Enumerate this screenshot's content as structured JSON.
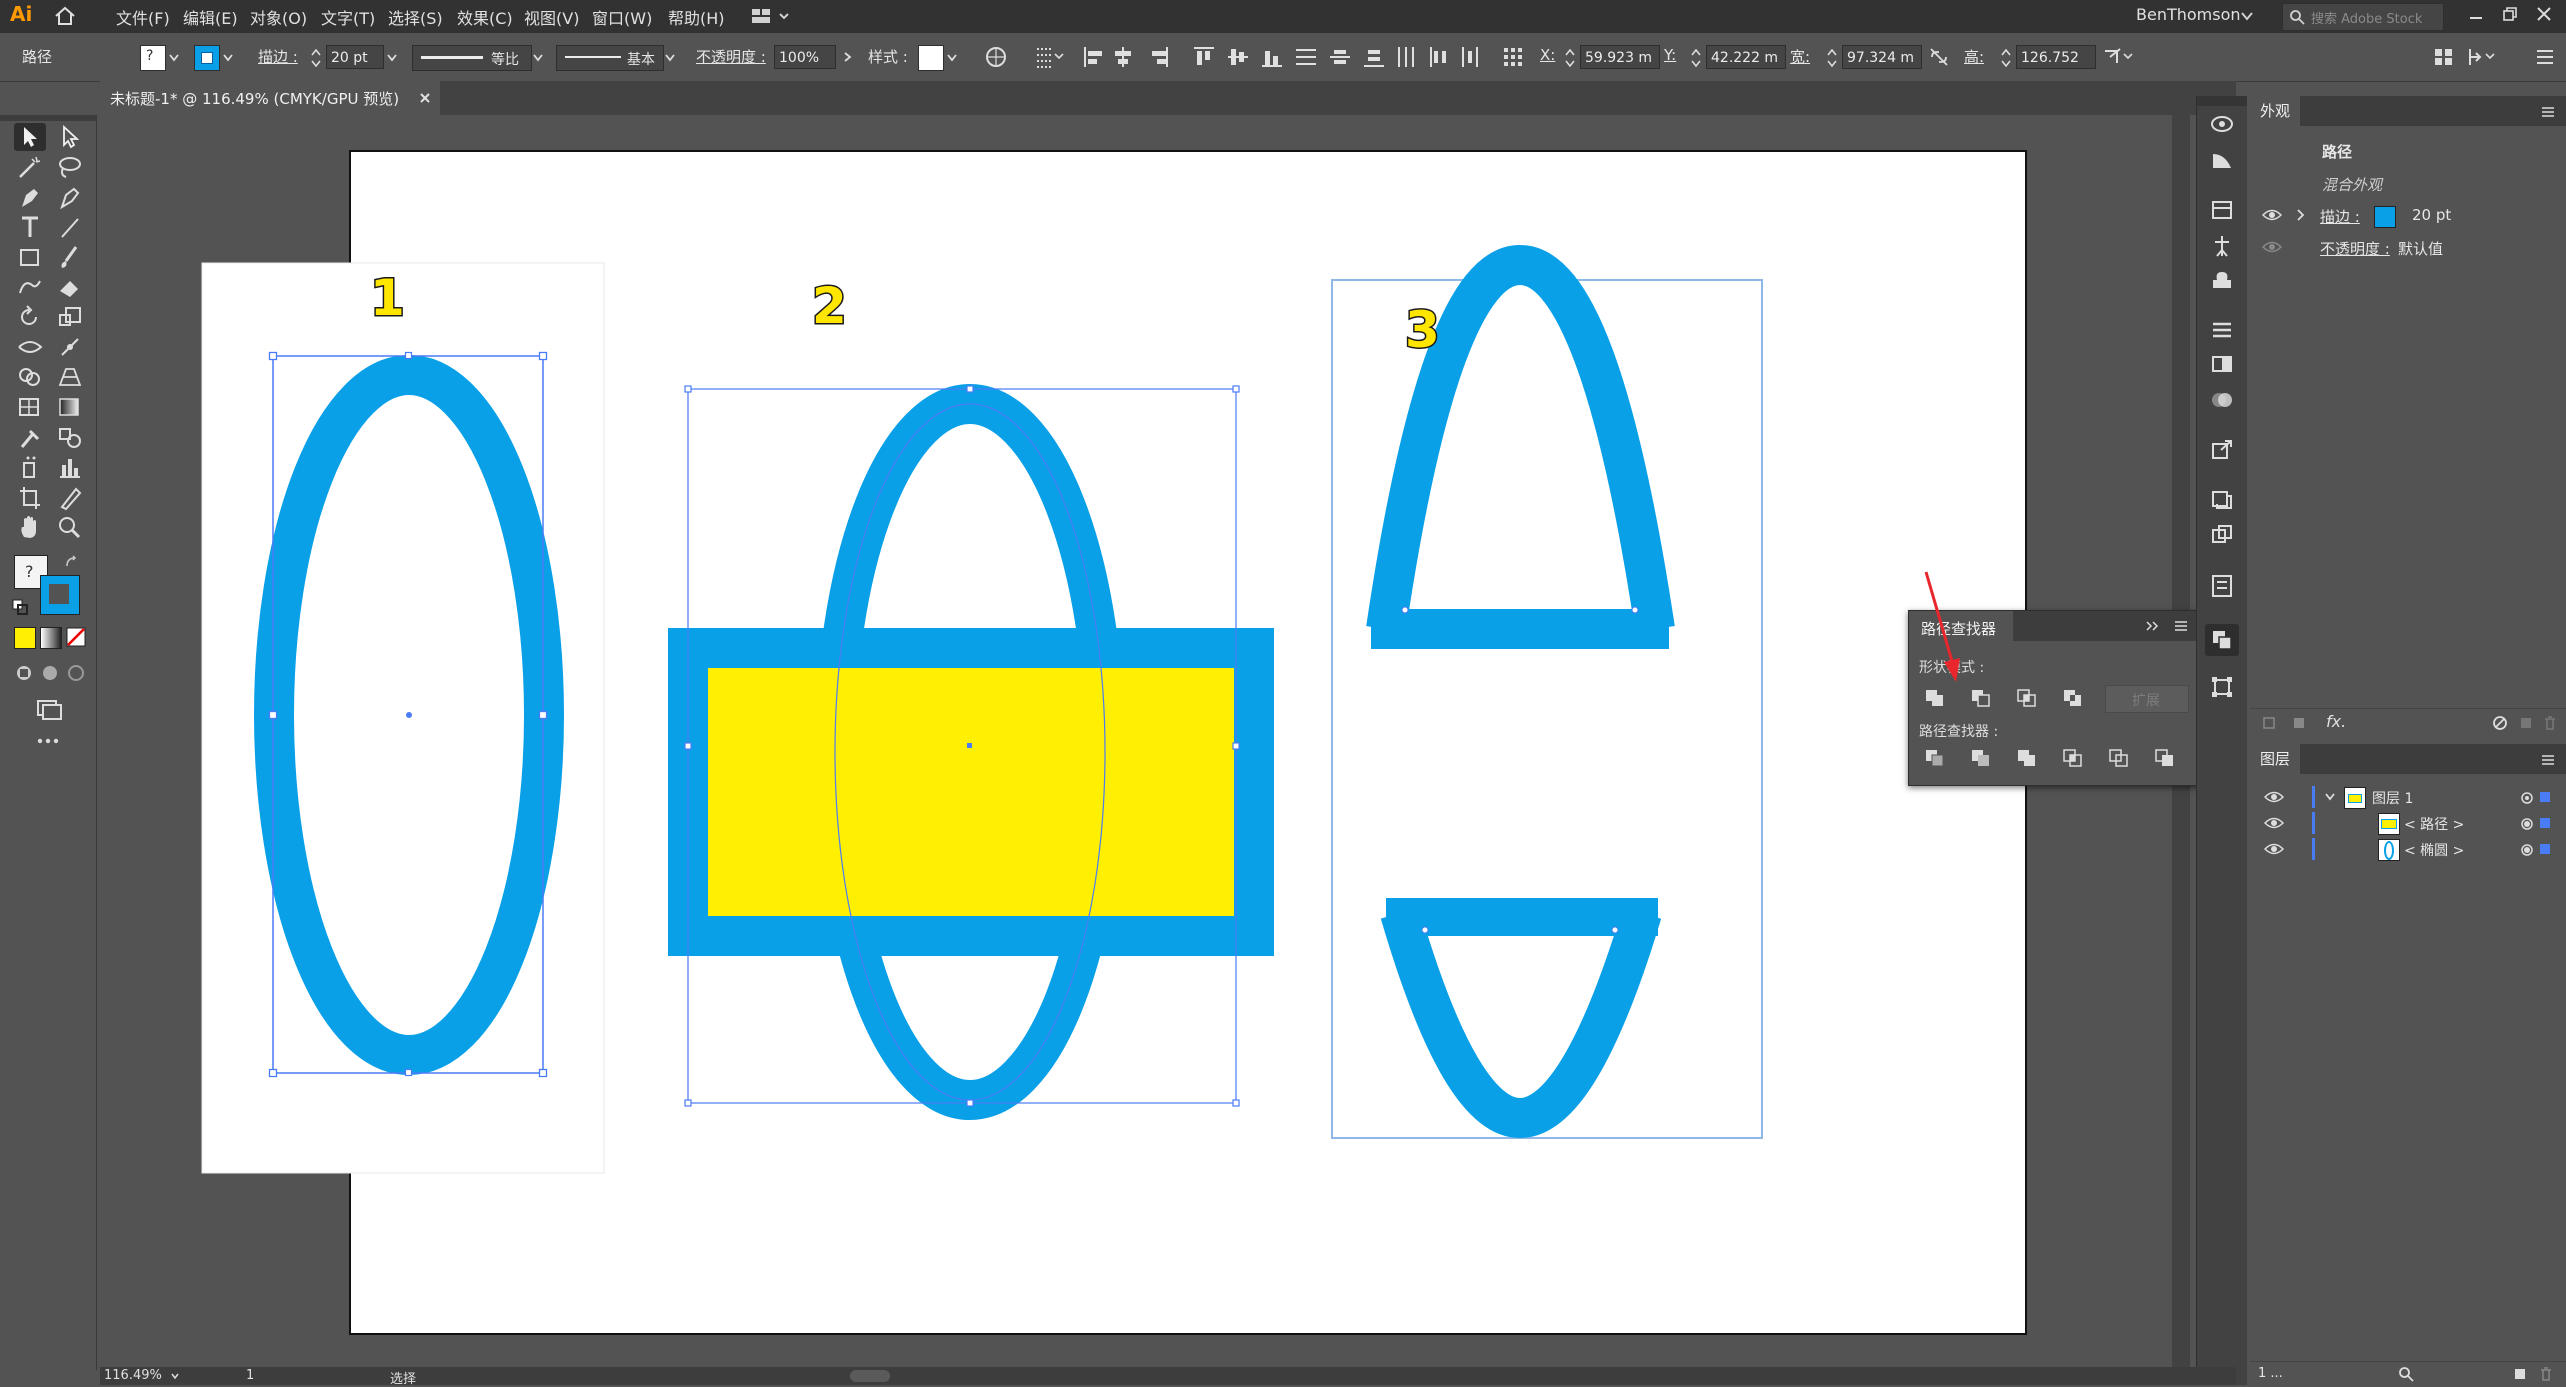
{
  "app": {
    "logo": "Ai",
    "menus": [
      "文件(F)",
      "编辑(E)",
      "对象(O)",
      "文字(T)",
      "选择(S)",
      "效果(C)",
      "视图(V)",
      "窗口(W)",
      "帮助(H)"
    ],
    "user": "BenThomson",
    "search_placeholder": "搜索 Adobe Stock"
  },
  "control_bar": {
    "selection_label": "路径",
    "stroke_label": "描边 :",
    "stroke_value": "20 pt",
    "profile_label": "等比",
    "brush_label": "基本",
    "opacity_label": "不透明度 :",
    "opacity_value": "100%",
    "style_label": "样式 :",
    "x_label": "X:",
    "x_value": "59.923 m",
    "y_label": "Y:",
    "y_value": "42.222 m",
    "w_label": "宽:",
    "w_value": "97.324 m",
    "h_label": "高:",
    "h_value": "126.752"
  },
  "document": {
    "tab_title": "未标题-1* @ 116.49% (CMYK/GPU 预览)"
  },
  "canvas": {
    "labels": [
      "1",
      "2",
      "3"
    ],
    "colors": {
      "stroke_blue": "#0aa0e8",
      "fill_yellow": "#ffef00",
      "selection": "#4a7cf5",
      "annotation_arrow": "#e8262c"
    }
  },
  "pathfinder": {
    "title": "路径查找器",
    "shape_modes_label": "形状模式 :",
    "expand_label": "扩展",
    "pathfinders_label": "路径查找器 :"
  },
  "appearance": {
    "tab": "外观",
    "object_title": "路径",
    "subtitle": "混合外观",
    "stroke_label": "描边 :",
    "stroke_value": "20 pt",
    "opacity_label": "不透明度 :",
    "opacity_value": "默认值",
    "fx_label": "fx."
  },
  "layers": {
    "tab": "图层",
    "items": [
      {
        "name": "图层 1"
      },
      {
        "name": "< 路径 >"
      },
      {
        "name": "< 椭圆 >"
      }
    ],
    "footer_count": "1 ..."
  },
  "status": {
    "zoom": "116.49%",
    "artboard": "1",
    "tool": "选择"
  }
}
